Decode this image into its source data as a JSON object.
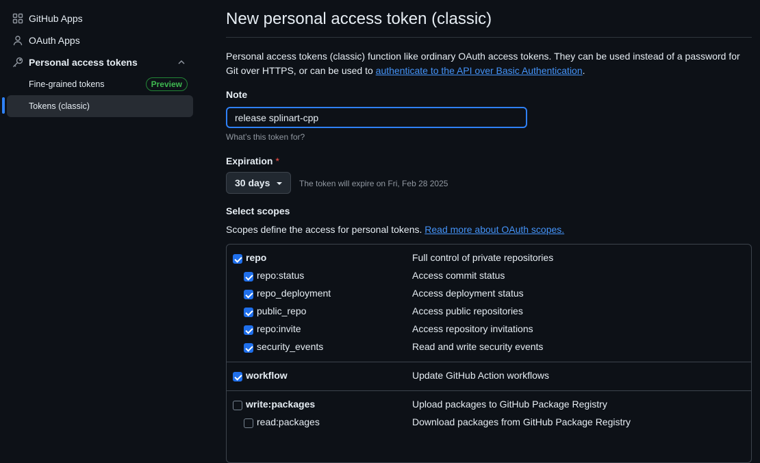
{
  "sidebar": {
    "github_apps": "GitHub Apps",
    "oauth_apps": "OAuth Apps",
    "pat": "Personal access tokens",
    "fine_grained": "Fine-grained tokens",
    "preview_badge": "Preview",
    "classic": "Tokens (classic)"
  },
  "page": {
    "title": "New personal access token (classic)",
    "desc_text": "Personal access tokens (classic) function like ordinary OAuth access tokens. They can be used instead of a password for Git over HTTPS, or can be used to ",
    "desc_link": "authenticate to the API over Basic Authentication",
    "desc_end": "."
  },
  "note": {
    "label": "Note",
    "value": "release splinart-cpp",
    "hint": "What’s this token for?"
  },
  "expiration": {
    "label": "Expiration",
    "required_mark": "*",
    "selected": "30 days",
    "expire_text": "The token will expire on Fri, Feb 28 2025"
  },
  "scopes": {
    "label": "Select scopes",
    "desc_text": "Scopes define the access for personal tokens. ",
    "desc_link": "Read more about OAuth scopes.",
    "groups": [
      {
        "name": "repo",
        "desc": "Full control of private repositories",
        "checked": true,
        "children": [
          {
            "name": "repo:status",
            "desc": "Access commit status",
            "checked": true
          },
          {
            "name": "repo_deployment",
            "desc": "Access deployment status",
            "checked": true
          },
          {
            "name": "public_repo",
            "desc": "Access public repositories",
            "checked": true
          },
          {
            "name": "repo:invite",
            "desc": "Access repository invitations",
            "checked": true
          },
          {
            "name": "security_events",
            "desc": "Read and write security events",
            "checked": true
          }
        ]
      },
      {
        "name": "workflow",
        "desc": "Update GitHub Action workflows",
        "checked": true,
        "children": []
      },
      {
        "name": "write:packages",
        "desc": "Upload packages to GitHub Package Registry",
        "checked": false,
        "children": [
          {
            "name": "read:packages",
            "desc": "Download packages from GitHub Package Registry",
            "checked": false
          }
        ]
      }
    ]
  }
}
